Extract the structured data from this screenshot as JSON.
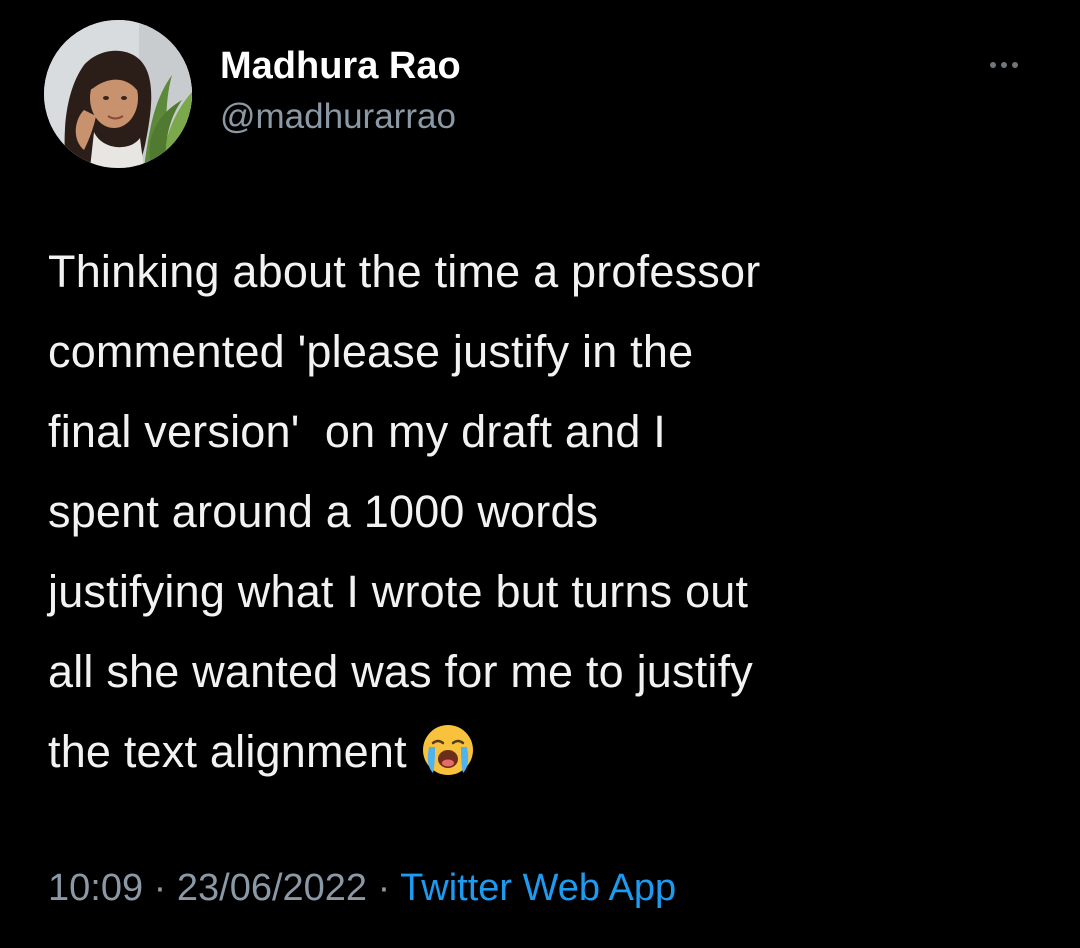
{
  "user": {
    "display_name": "Madhura Rao",
    "handle": "@madhurarrao",
    "avatar_icon": "profile-photo"
  },
  "tweet": {
    "lines": [
      "Thinking about the time a professor",
      "commented 'please justify in the",
      "final version'  on my draft and I",
      "spent around a 1000 words",
      "justifying what I wrote but turns out",
      "all she wanted was for me to justify",
      "the text alignment"
    ],
    "emoji": "loudly-crying-face"
  },
  "meta": {
    "time": "10:09",
    "separator1": " · ",
    "date": "23/06/2022",
    "separator2": " · ",
    "source": "Twitter Web App"
  },
  "colors": {
    "background": "#000000",
    "text": "#f2f2f2",
    "secondary": "#8b98a5",
    "link": "#1d9bf0"
  },
  "more_icon": "more-horizontal-icon"
}
